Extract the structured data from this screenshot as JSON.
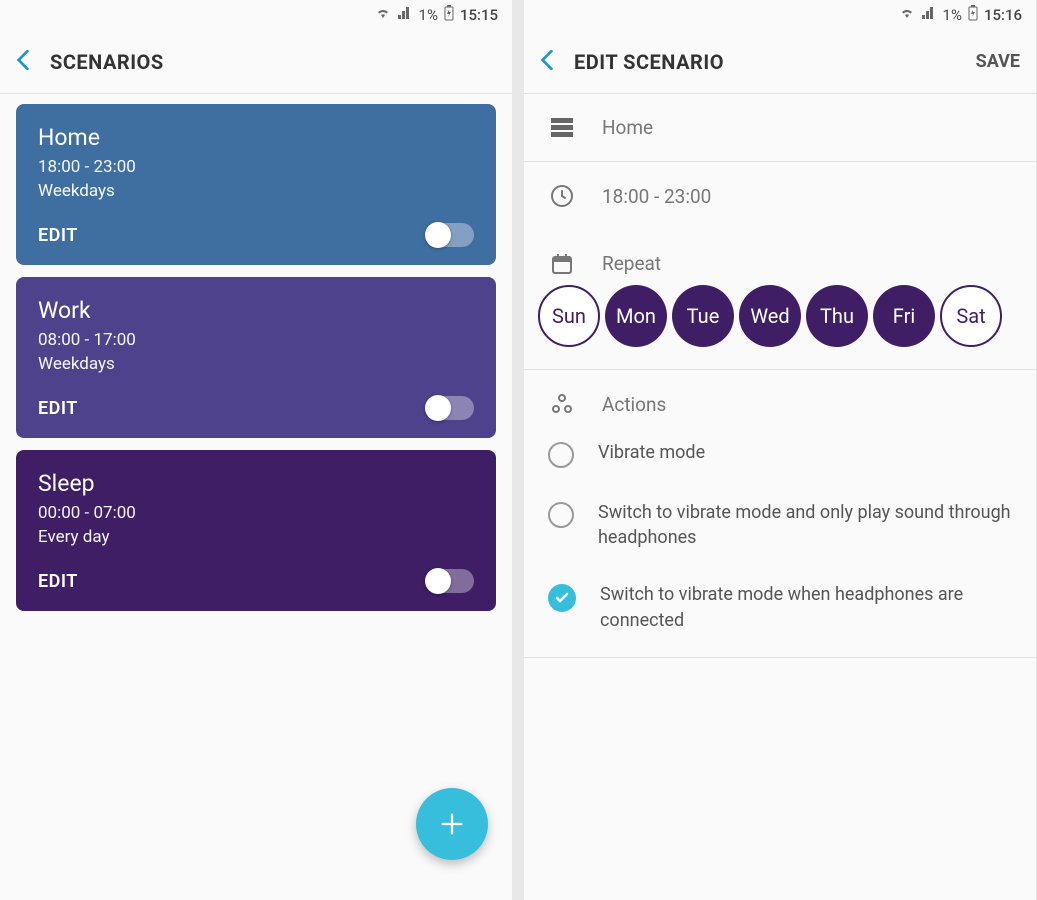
{
  "left": {
    "status": {
      "battery": "1%",
      "time": "15:15"
    },
    "title": "SCENARIOS",
    "cards": [
      {
        "name": "Home",
        "time": "18:00 - 23:00",
        "days": "Weekdays",
        "edit": "EDIT",
        "color": "#3f6ea0"
      },
      {
        "name": "Work",
        "time": "08:00 - 17:00",
        "days": "Weekdays",
        "edit": "EDIT",
        "color": "#4e428c"
      },
      {
        "name": "Sleep",
        "time": "00:00 - 07:00",
        "days": "Every day",
        "edit": "EDIT",
        "color": "#3f1e66"
      }
    ]
  },
  "right": {
    "status": {
      "battery": "1%",
      "time": "15:16"
    },
    "title": "EDIT SCENARIO",
    "save": "SAVE",
    "name": "Home",
    "time": "18:00 - 23:00",
    "repeat_label": "Repeat",
    "days": [
      {
        "label": "Sun",
        "on": false
      },
      {
        "label": "Mon",
        "on": true
      },
      {
        "label": "Tue",
        "on": true
      },
      {
        "label": "Wed",
        "on": true
      },
      {
        "label": "Thu",
        "on": true
      },
      {
        "label": "Fri",
        "on": true
      },
      {
        "label": "Sat",
        "on": false
      }
    ],
    "actions_label": "Actions",
    "actions": [
      {
        "text": "Vibrate mode",
        "checked": false
      },
      {
        "text": "Switch to vibrate mode and only play sound through headphones",
        "checked": false
      },
      {
        "text": "Switch to vibrate mode when headphones are connected",
        "checked": true
      }
    ]
  }
}
